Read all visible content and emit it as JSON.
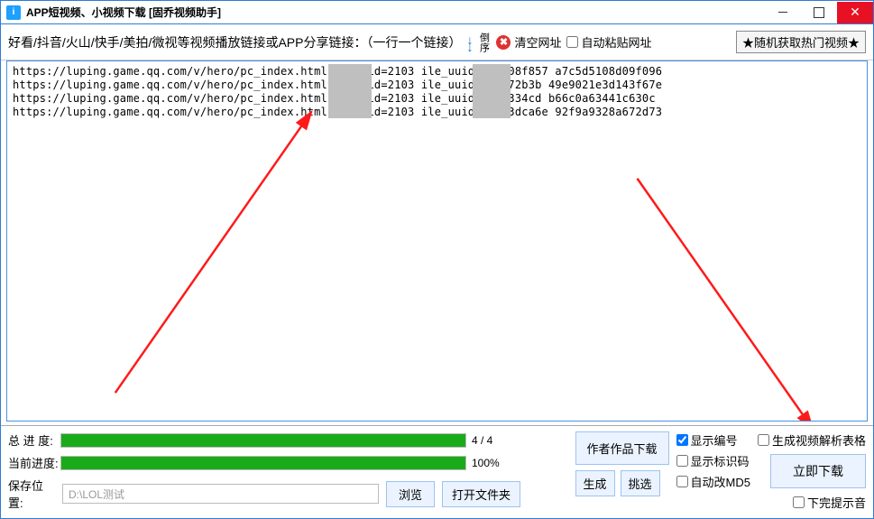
{
  "titlebar": {
    "icon_text": "i",
    "title": "APP短视频、小视频下载 [固乔视频助手]"
  },
  "toolbar": {
    "hint": "好看/抖音/火山/快手/美拍/微视等视频播放链接或APP分享链接：（一行一个链接）",
    "sort_label": "倒序",
    "clear_label": "清空网址",
    "auto_paste_label": "自动粘贴网址",
    "random_hot_label": "★随机获取热门视频★"
  },
  "urls": [
    "https://luping.game.qq.com/v/hero/pc_index.html?game_id=2103       ile_uuid=ffff08f857      a7c5d5108d09f096",
    "https://luping.game.qq.com/v/hero/pc_index.html?game_id=2103       ile_uuid=fff972b3b       49e9021e3d143f67e",
    "https://luping.game.qq.com/v/hero/pc_index.html?game_id=2103       ile_uuid=ffff334cd       b66c0a63441c630c",
    "https://luping.game.qq.com/v/hero/pc_index.html?game_id=2103       ile_uuid=ff7a3dca6e      92f9a9328a672d73"
  ],
  "bottom": {
    "total_label": "总 进 度:",
    "total_text": "4 / 4",
    "current_label": "当前进度:",
    "current_text": "100%",
    "save_label": "保存位置:",
    "save_path": "D:\\LOL测试",
    "browse": "浏览",
    "open_folder": "打开文件夹",
    "gen_btn": "生成",
    "pick_btn": "挑选",
    "author_dl": "作者作品下载",
    "show_number": "显示编号",
    "show_code": "显示标识码",
    "auto_md5": "自动改MD5",
    "gen_table": "生成视频解析表格",
    "download_now": "立即下载",
    "done_sound": "下完提示音"
  }
}
